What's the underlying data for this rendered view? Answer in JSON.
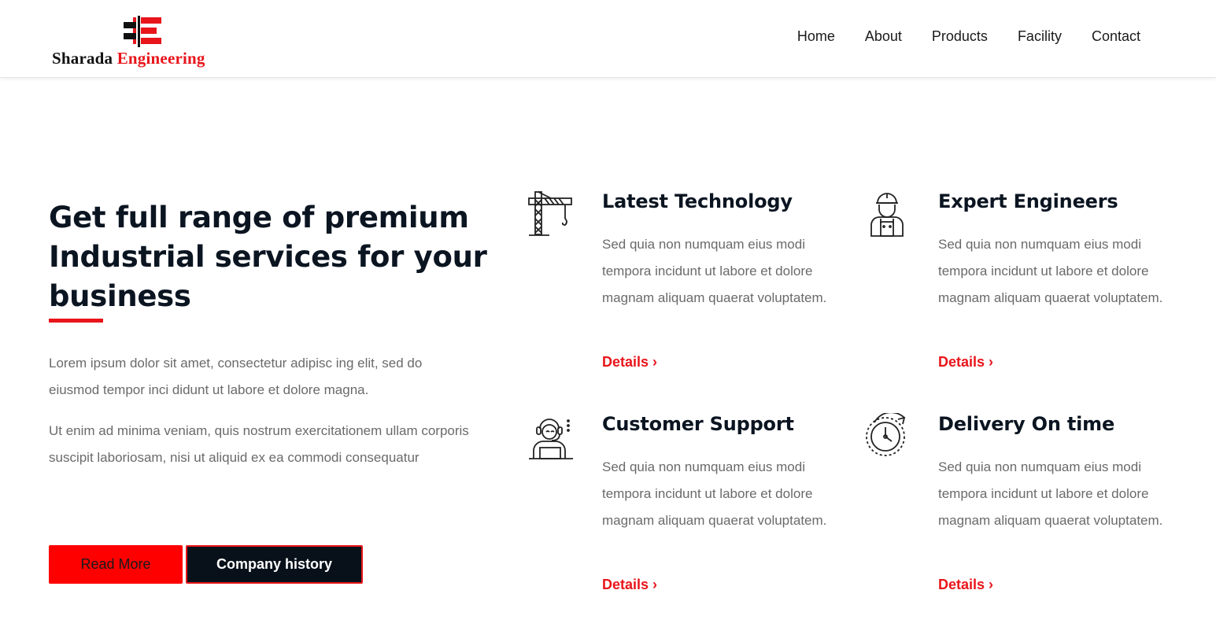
{
  "brand": {
    "name_part1": "Sharada",
    "name_part2": "Engineering",
    "colors": {
      "accent": "#e8151b",
      "dark": "#0b1521"
    }
  },
  "nav": {
    "items": [
      {
        "label": "Home"
      },
      {
        "label": "About"
      },
      {
        "label": "Products"
      },
      {
        "label": "Facility"
      },
      {
        "label": "Contact"
      }
    ]
  },
  "hero": {
    "title": "Get full range of premium Industrial services for your business",
    "paragraph1": "Lorem ipsum dolor sit amet, consectetur adipisc ing elit, sed do eiusmod tempor inci didunt ut labore et dolore magna.",
    "paragraph2": "Ut enim ad minima veniam, quis nostrum exercitationem ullam corporis suscipit laboriosam, nisi ut aliquid ex ea commodi consequatur",
    "read_more_label": "Read More",
    "history_label": "Company history"
  },
  "features": [
    {
      "title": "Latest Technology",
      "icon": "crane-icon",
      "description": "Sed quia non numquam eius modi tempora incidunt ut labore et dolore magnam aliquam quaerat voluptatem.",
      "link_label": "Details ›"
    },
    {
      "title": "Expert Engineers",
      "icon": "engineer-icon",
      "description": "Sed quia non numquam eius modi tempora incidunt ut labore et dolore magnam aliquam quaerat voluptatem.",
      "link_label": "Details ›"
    },
    {
      "title": "Customer Support",
      "icon": "support-agent-icon",
      "description": "Sed quia non numquam eius modi tempora incidunt ut labore et dolore magnam aliquam quaerat voluptatem.",
      "link_label": "Details ›"
    },
    {
      "title": "Delivery On time",
      "icon": "clock-icon",
      "description": "Sed quia non numquam eius modi tempora incidunt ut labore et dolore magnam aliquam quaerat voluptatem.",
      "link_label": "Details ›"
    }
  ]
}
